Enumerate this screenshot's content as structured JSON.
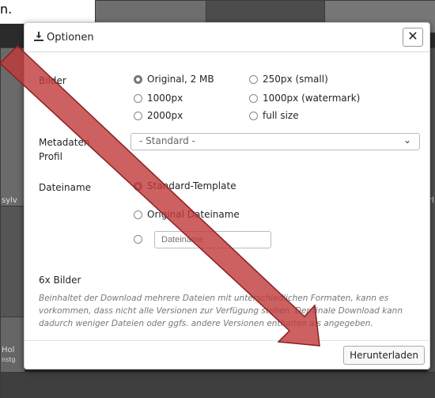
{
  "background": {
    "top_text": "n.",
    "side_texts": [
      "sylv",
      "Hol",
      "nstg",
      "rl"
    ]
  },
  "dialog": {
    "title": "Optionen",
    "close_label": "✕",
    "images_label": "Bilder",
    "image_options": [
      "Original, 2 MB",
      "250px (small)",
      "1000px",
      "1000px (watermark)",
      "2000px",
      "full size"
    ],
    "image_selected": "Original, 2 MB",
    "metadata_label": "Metadaten Profil",
    "metadata_value": "- Standard -",
    "filename_label": "Dateiname",
    "filename_options": [
      "Standard-Template",
      "Original Dateiname"
    ],
    "filename_placeholder": "Dateiname",
    "count_text": "6x Bilder",
    "note": "Beinhaltet der Download mehrere Dateien mit unterschiedlichen Formaten, kann es vorkommen, dass nicht alle Versionen zur Verfügung stehen. Der finale Download kann dadurch weniger Dateien oder ggfs. andere Versionen enthalten als angegeben.",
    "download_label": "Herunterladen"
  },
  "annotation": {
    "arrow_color": "#c0393b"
  }
}
